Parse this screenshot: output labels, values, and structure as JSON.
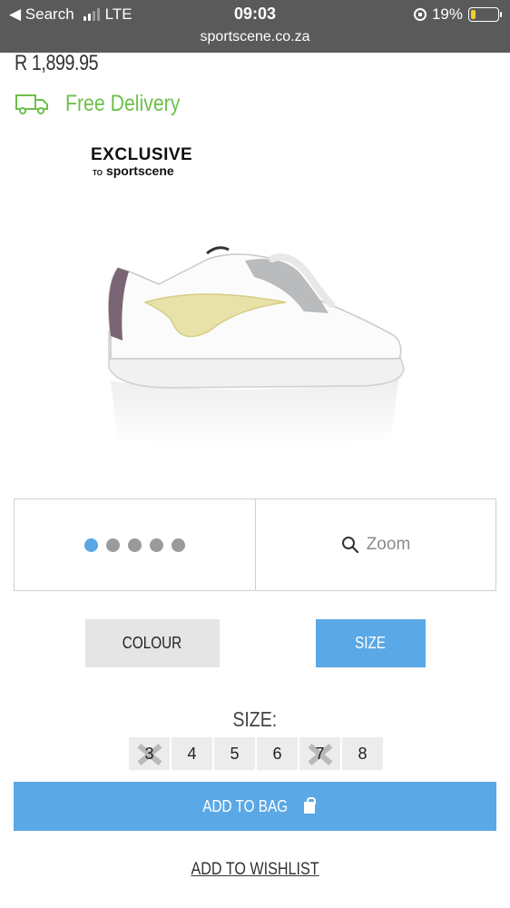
{
  "status_bar": {
    "back_label": "◀ Search",
    "network": "LTE",
    "time": "09:03",
    "battery": "19%",
    "battery_level": 0.19,
    "url": "sportscene.co.za"
  },
  "product": {
    "price": "R 1,899.95",
    "delivery": "Free Delivery",
    "badge_title": "EXCLUSIVE",
    "badge_to": "TO",
    "badge_brand": "sportscene"
  },
  "gallery": {
    "dots": [
      true,
      false,
      false,
      false,
      false
    ],
    "zoom_label": "Zoom"
  },
  "options": {
    "colour_label": "COLOUR",
    "size_label": "SIZE"
  },
  "size_selector": {
    "title": "SIZE:",
    "sizes": [
      {
        "label": "3",
        "available": false
      },
      {
        "label": "4",
        "available": true
      },
      {
        "label": "5",
        "available": true
      },
      {
        "label": "6",
        "available": true
      },
      {
        "label": "7",
        "available": false
      },
      {
        "label": "8",
        "available": true
      }
    ]
  },
  "actions": {
    "add_to_bag": "ADD TO BAG",
    "add_to_wishlist": "ADD TO WISHLIST"
  },
  "colors": {
    "accent": "#5aa8e6",
    "delivery_green": "#6cc04a",
    "statusbar": "#5a5a5a"
  }
}
